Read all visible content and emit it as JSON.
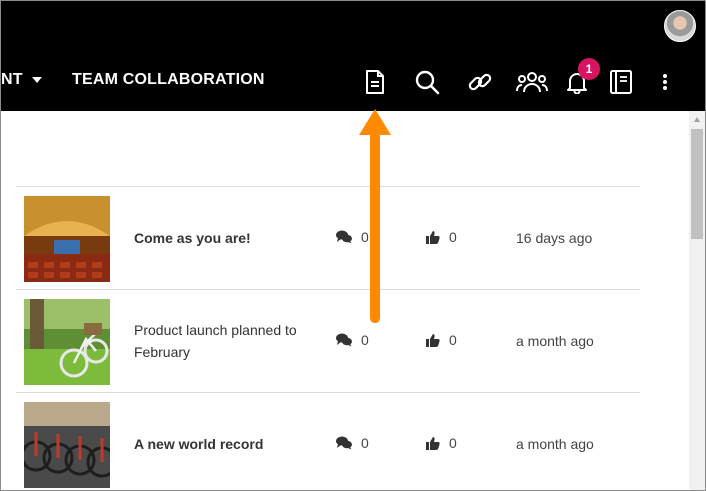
{
  "header": {
    "nav_prev_label": "NT",
    "nav_team_label": "TEAM COLLABORATION",
    "notification_count": "1",
    "icons": [
      "document-icon",
      "search-icon",
      "link-icon",
      "people-icon",
      "bell-icon",
      "book-icon",
      "more-vertical-icon"
    ]
  },
  "colors": {
    "header_bg": "#000000",
    "badge": "#d6145f",
    "arrow": "#ff8a00"
  },
  "rows": [
    {
      "title": "Come as you are!",
      "bold": true,
      "comments": "0",
      "likes": "0",
      "date": "16 days ago",
      "image": "auditorium"
    },
    {
      "title": "Product launch planned to February",
      "bold": false,
      "comments": "0",
      "likes": "0",
      "date": "a month ago",
      "image": "bicycle-on-grass"
    },
    {
      "title": "A new world record",
      "bold": true,
      "comments": "0",
      "likes": "0",
      "date": "a month ago",
      "image": "bicycle-rack"
    }
  ]
}
